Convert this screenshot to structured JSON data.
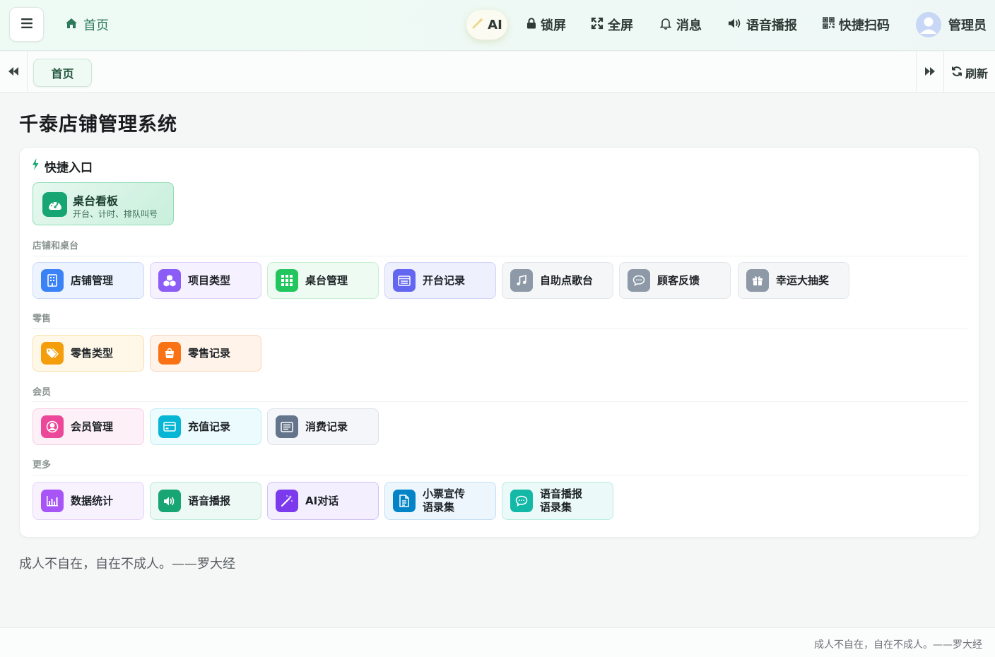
{
  "header": {
    "home_label": "首页",
    "ai_label": "AI",
    "tools": {
      "lock": "锁屏",
      "fullscreen": "全屏",
      "messages": "消息",
      "voice": "语音播报",
      "scan": "快捷扫码"
    },
    "user_name": "管理员"
  },
  "tabs": {
    "home": "首页",
    "refresh": "刷新"
  },
  "page": {
    "title": "千泰店铺管理系统"
  },
  "quick": {
    "heading": "快捷入口",
    "featured": {
      "title": "桌台看板",
      "subtitle": "开台、计时、排队叫号"
    },
    "sections": {
      "store": "店铺和桌台",
      "retail": "零售",
      "member": "会员",
      "more": "更多"
    },
    "store_items": [
      "店铺管理",
      "项目类型",
      "桌台管理",
      "开台记录",
      "自助点歌台",
      "顾客反馈",
      "幸运大抽奖"
    ],
    "retail_items": [
      "零售类型",
      "零售记录"
    ],
    "member_items": [
      "会员管理",
      "充值记录",
      "消费记录"
    ],
    "more_items": [
      "数据统计",
      "语音播报",
      "AI对话",
      "小票宣传\n语录集",
      "语音播报\n语录集"
    ]
  },
  "quote": "成人不自在，自在不成人。——罗大经",
  "footer": "成人不自在，自在不成人。——罗大经",
  "colors": {
    "accent": "#17a673",
    "blue": "#3b82f6",
    "purple": "#8b5cf6",
    "green": "#22c55e",
    "indigo": "#6366f1",
    "gray": "#8e99a8",
    "amber": "#f59e0b",
    "orange": "#f97316",
    "pink": "#ec4899",
    "cyan": "#06b6d4",
    "slate": "#64748b",
    "violet": "#a855f7",
    "teal": "#14b8a6",
    "sky": "#0284c7"
  }
}
